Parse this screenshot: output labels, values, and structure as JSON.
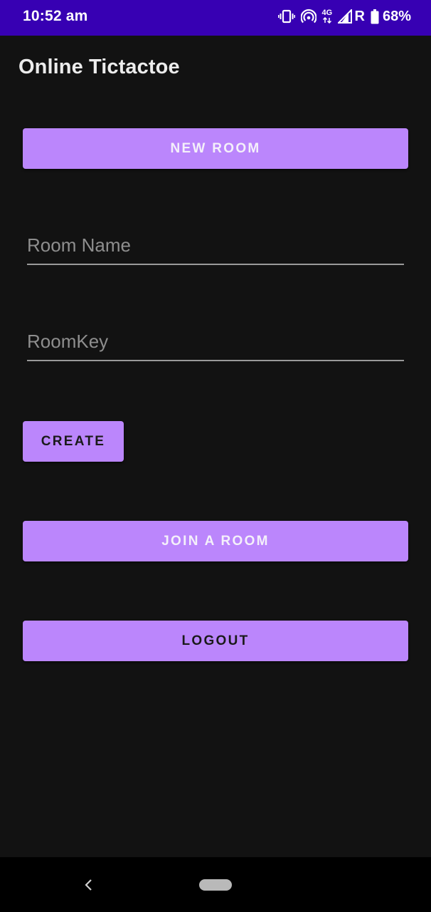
{
  "status_bar": {
    "time": "10:52 am",
    "network_label": "4G",
    "roaming": "R",
    "battery": "68%",
    "color": "#3700b3",
    "icons": [
      "vibrate-icon",
      "hotspot-icon",
      "network-4g-icon",
      "signal-icon",
      "battery-icon"
    ]
  },
  "app": {
    "title": "Online Tictactoe"
  },
  "main": {
    "new_room_label": "NEW ROOM",
    "room_name_placeholder": "Room Name",
    "room_key_placeholder": "RoomKey",
    "create_label": "CREATE",
    "join_label": "JOIN A ROOM",
    "logout_label": "LOGOUT"
  },
  "nav_bar": {
    "icons": [
      "back-icon",
      "home-pill-icon"
    ]
  },
  "colors": {
    "accent": "#bb86fc",
    "background": "#121212"
  }
}
